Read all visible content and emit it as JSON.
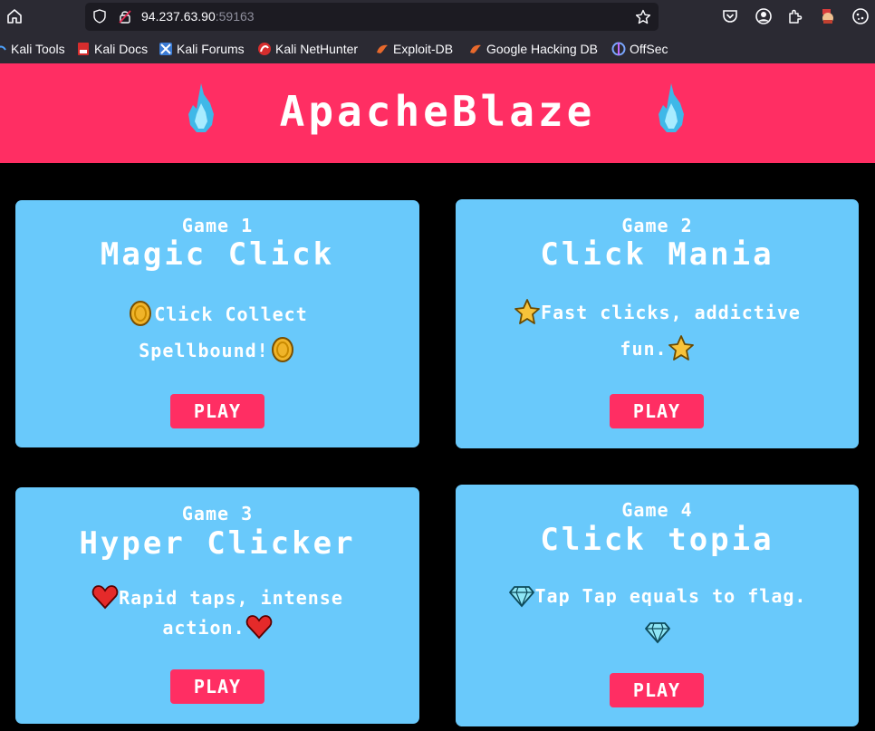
{
  "browser": {
    "url_host": "94.237.63.90",
    "url_port": ":59163",
    "bookmarks": [
      {
        "label": "Kali Tools",
        "icon": "kali-icon"
      },
      {
        "label": "Kali Docs",
        "icon": "kali-docs-icon"
      },
      {
        "label": "Kali Forums",
        "icon": "kali-forums-icon"
      },
      {
        "label": "Kali NetHunter",
        "icon": "nethunter-icon"
      },
      {
        "label": "Exploit-DB",
        "icon": "exploit-db-icon"
      },
      {
        "label": "Google Hacking DB",
        "icon": "ghdb-icon"
      },
      {
        "label": "OffSec",
        "icon": "offsec-icon"
      }
    ]
  },
  "page": {
    "title": "ApacheBlaze",
    "banner_icon": "blue-flame-icon",
    "accent_color": "#ff2e63",
    "card_color": "#69c9fb"
  },
  "games": [
    {
      "number": "Game 1",
      "title": "Magic Click",
      "desc_a": "Click Collect",
      "desc_b": "Spellbound!",
      "icon": "gold-coin-icon",
      "play_label": "PLAY"
    },
    {
      "number": "Game 2",
      "title": "Click Mania",
      "desc_a": "Fast clicks, addictive",
      "desc_b": "fun.",
      "icon": "star-icon",
      "play_label": "PLAY"
    },
    {
      "number": "Game 3",
      "title": "Hyper Clicker",
      "desc_a": "Rapid taps, intense",
      "desc_b": "action.",
      "icon": "heart-icon",
      "play_label": "PLAY"
    },
    {
      "number": "Game 4",
      "title": "Click topia",
      "desc_a": "Tap Tap equals to flag.",
      "desc_b": "",
      "icon": "diamond-icon",
      "play_label": "PLAY"
    }
  ]
}
